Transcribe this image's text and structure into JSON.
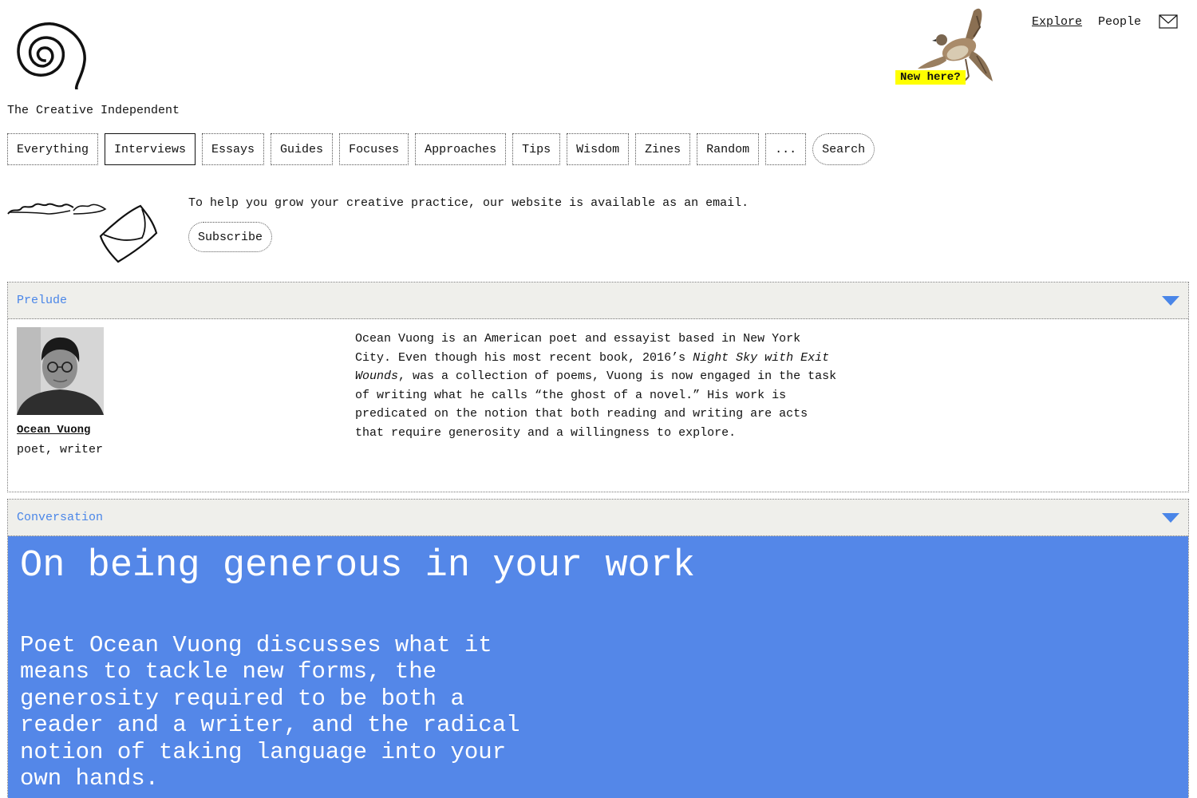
{
  "site": {
    "name": "The Creative Independent",
    "new_here": "New here?"
  },
  "topnav": {
    "explore": "Explore",
    "people": "People"
  },
  "categories": [
    {
      "label": "Everything"
    },
    {
      "label": "Interviews",
      "active": true
    },
    {
      "label": "Essays"
    },
    {
      "label": "Guides"
    },
    {
      "label": "Focuses"
    },
    {
      "label": "Approaches"
    },
    {
      "label": "Tips"
    },
    {
      "label": "Wisdom"
    },
    {
      "label": "Zines"
    },
    {
      "label": "Random"
    },
    {
      "label": "..."
    },
    {
      "label": "Search"
    }
  ],
  "promo": {
    "text": "To help you grow your creative practice, our website is available as an email.",
    "button": "Subscribe"
  },
  "prelude": {
    "header": "Prelude",
    "author_name": "Ocean Vuong",
    "author_role": "poet, writer",
    "bio_part1": "Ocean Vuong is an American poet and essayist based in New York City. Even though his most recent book, 2016’s ",
    "bio_italic": "Night Sky with Exit Wounds",
    "bio_part2": ", was a collection of poems, Vuong is now engaged in the task of writing what he calls “the ghost of a novel.” His work is predicated on the notion that both reading and writing are acts that require generosity and a willingness to explore."
  },
  "conversation": {
    "header": "Conversation",
    "title": "On being generous in your work",
    "dek": "Poet Ocean Vuong discusses what it means to tackle new forms, the generosity required to be both a reader and a writer, and the radical notion of taking language into your own hands."
  },
  "colors": {
    "accent": "#4a86e8",
    "hero_bg": "#5487e8",
    "header_bg": "#efefeb",
    "badge": "#ffff00"
  }
}
